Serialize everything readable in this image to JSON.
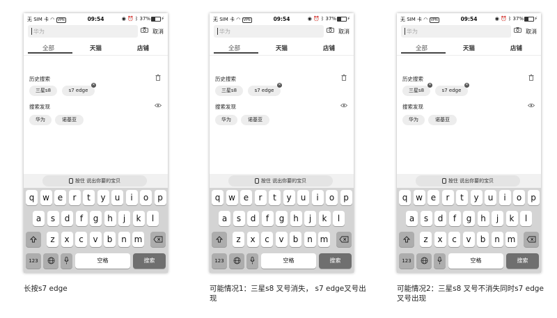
{
  "status_bar": {
    "carrier": "无 SIM 卡",
    "vpn": "VPN",
    "time": "09:54",
    "battery": "37%"
  },
  "search": {
    "placeholder": "华为",
    "cancel_label": "取消"
  },
  "tabs": [
    "全部",
    "天猫",
    "店铺"
  ],
  "history": {
    "title": "历史搜索",
    "items": [
      "三星s8",
      "s7 edge"
    ]
  },
  "discover": {
    "title": "搜索发现",
    "items": [
      "华为",
      "诺基亚"
    ]
  },
  "voice": {
    "press_label": "按住",
    "hint": "说出你要的宝贝"
  },
  "keyboard": {
    "row1": [
      "q",
      "w",
      "e",
      "r",
      "t",
      "y",
      "u",
      "i",
      "o",
      "p"
    ],
    "row2": [
      "a",
      "s",
      "d",
      "f",
      "g",
      "h",
      "j",
      "k",
      "l"
    ],
    "row3": [
      "z",
      "x",
      "c",
      "v",
      "b",
      "n",
      "m"
    ],
    "num_label": "123",
    "space_label": "空格",
    "search_label": "搜索"
  },
  "screens": [
    {
      "caption": "长按s7 edge",
      "close_badges": [
        1
      ]
    },
    {
      "caption": "可能情况1：三星s8 叉号消失， s7 edge叉号出现",
      "close_badges": [
        1
      ]
    },
    {
      "caption": "可能情况2：三星s8 叉号不消失同时s7 edge叉号出现",
      "close_badges": [
        0,
        1
      ]
    }
  ],
  "colors": {
    "keyboard_bg": "#d4d4d4",
    "search_key": "#6f6f6f",
    "chip_bg": "#ededed"
  }
}
